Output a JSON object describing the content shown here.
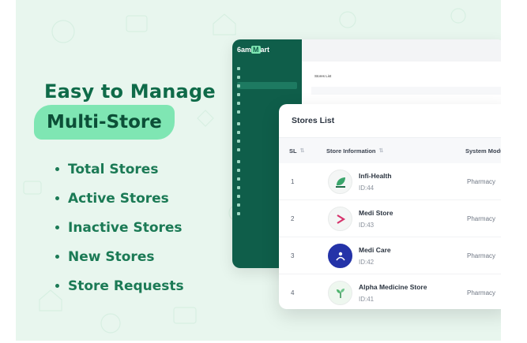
{
  "marketing": {
    "headline": "Easy to Manage",
    "highlight": "Multi-Store",
    "features": [
      "Total Stores",
      "Active Stores",
      "Inactive Stores",
      "New Stores",
      "Store Requests"
    ]
  },
  "dashboard_bg": {
    "logo_prefix": "6am",
    "logo_mid": "M",
    "logo_suffix": "art",
    "panel_title": "Stores List"
  },
  "stores_card": {
    "title": "Stores List",
    "columns": {
      "sl": "SL",
      "info": "Store Information",
      "module": "System Modu"
    },
    "rows": [
      {
        "sl": "1",
        "name": "Infi-Health",
        "id": "ID:44",
        "module": "Pharmacy",
        "logo_icon": "leaf-icon"
      },
      {
        "sl": "2",
        "name": "Medi Store",
        "id": "ID:43",
        "module": "Pharmacy",
        "logo_icon": "pill-icon"
      },
      {
        "sl": "3",
        "name": "Medi Care",
        "id": "ID:42",
        "module": "Pharmacy",
        "logo_icon": "care-icon"
      },
      {
        "sl": "4",
        "name": "Alpha Medicine Store",
        "id": "ID:41",
        "module": "Pharmacy",
        "logo_icon": "plant-icon"
      }
    ]
  },
  "colors": {
    "brand_green": "#0f6b49",
    "accent_mint": "#7fe6b3",
    "sidebar": "#0f5e4a",
    "background": "#e8f6ee"
  }
}
